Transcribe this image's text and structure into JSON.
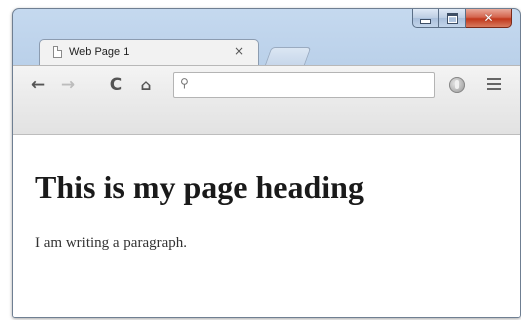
{
  "window": {
    "caption_buttons": {
      "minimize_icon": "minimize-icon",
      "maximize_icon": "maximize-icon",
      "close_icon": "close-icon",
      "close_glyph": "✕"
    }
  },
  "tab": {
    "title": "Web Page 1",
    "close_glyph": "×",
    "icon": "page-icon"
  },
  "toolbar": {
    "back_glyph": "←",
    "forward_glyph": "→",
    "reload_glyph": "C",
    "home_glyph": "⌂",
    "search_glyph": "🔍",
    "address_value": "",
    "address_placeholder": "",
    "extension_icon": "extension-icon",
    "menu_icon": "hamburger-menu-icon"
  },
  "page": {
    "heading": "This is my page heading",
    "paragraph": "I am writing a paragraph."
  },
  "colors": {
    "frame": "#b3cbe6",
    "close_button": "#c1381c",
    "toolbar": "#ececec",
    "content_bg": "#ffffff"
  }
}
